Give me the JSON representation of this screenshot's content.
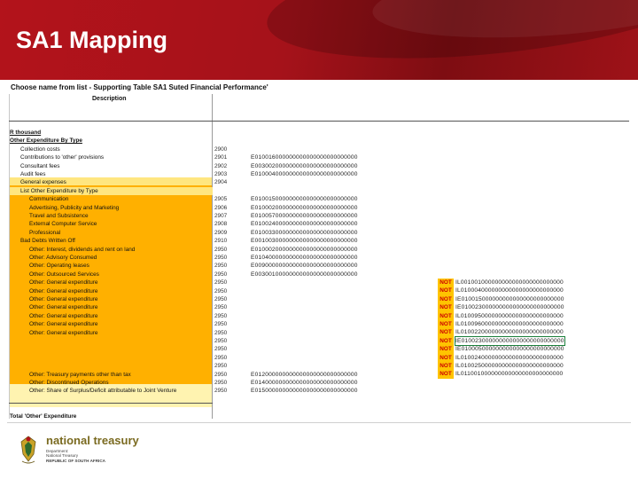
{
  "slide": {
    "title": "SA1 Mapping"
  },
  "sheet": {
    "title": "Choose name from list - Supporting Table SA1 Suted Financial Performance'",
    "description_header": "Description",
    "rows": [
      {
        "label": "R thousand",
        "code": "",
        "mapping": "",
        "style": "bold u"
      },
      {
        "label": "Other Expenditure By Type",
        "code": "",
        "mapping": "",
        "style": "bold u"
      },
      {
        "label": "Collection costs",
        "code": "2900",
        "mapping": "",
        "style": "indent1"
      },
      {
        "label": "Contributions to 'other' provisions",
        "code": "2901",
        "mapping": "E010016000000000000000000000000",
        "style": "indent1"
      },
      {
        "label": "Consultant fees",
        "code": "2902",
        "mapping": "E003002000000000000000000000000",
        "style": "indent1"
      },
      {
        "label": "Audit fees",
        "code": "2903",
        "mapping": "E010004000000000000000000000000",
        "style": "indent1"
      },
      {
        "label": "General expenses",
        "code": "2904",
        "mapping": "",
        "style": "indent1"
      },
      {
        "label": "List Other Expenditure by Type",
        "code": "",
        "mapping": "",
        "style": "indent1 yellow-bar"
      },
      {
        "label": "Communication",
        "code": "2905",
        "mapping": "E010015000000000000000000000000",
        "style": "indent2"
      },
      {
        "label": "Advertising, Publicity and Marketing",
        "code": "2906",
        "mapping": "E010002000000000000000000000000",
        "style": "indent2"
      },
      {
        "label": "Travel and Subsistence",
        "code": "2907",
        "mapping": "E010057000000000000000000000000",
        "style": "indent2"
      },
      {
        "label": "External Computer Service",
        "code": "2908",
        "mapping": "E010024000000000000000000000000",
        "style": "indent2"
      },
      {
        "label": "Professional",
        "code": "2909",
        "mapping": "E010033000000000000000000000000",
        "style": "indent2"
      },
      {
        "label": "Bad Debts Written Off",
        "code": "2910",
        "mapping": "E001003000000000000000000000000",
        "style": "indent1"
      },
      {
        "label": "Other: Interest, dividends and rent on land",
        "code": "2950",
        "mapping": "E010002000000000000000000000000",
        "style": "indent2"
      },
      {
        "label": "Other: Advisory Consumed",
        "code": "2950",
        "mapping": "E010400000000000000000000000000",
        "style": "indent2"
      },
      {
        "label": "Other: Operating leases",
        "code": "2950",
        "mapping": "E009000000000000000000000000000",
        "style": "indent2"
      },
      {
        "label": "Other: Outsourced Services",
        "code": "2950",
        "mapping": "E003001000000000000000000000000",
        "style": "indent2"
      },
      {
        "label": "Other: General expenditure",
        "code": "2950",
        "mapping": "",
        "style": "indent2"
      },
      {
        "label": "Other: General expenditure",
        "code": "2950",
        "mapping": "",
        "style": "indent2"
      },
      {
        "label": "Other: General expenditure",
        "code": "2950",
        "mapping": "",
        "style": "indent2"
      },
      {
        "label": "Other: General expenditure",
        "code": "2950",
        "mapping": "",
        "style": "indent2"
      },
      {
        "label": "Other: General expenditure",
        "code": "2950",
        "mapping": "",
        "style": "indent2"
      },
      {
        "label": "Other: General expenditure",
        "code": "2950",
        "mapping": "",
        "style": "indent2"
      },
      {
        "label": "Other: General expenditure",
        "code": "2950",
        "mapping": "",
        "style": "indent2"
      },
      {
        "label": "",
        "code": "2950",
        "mapping": "",
        "style": "indent2"
      },
      {
        "label": "",
        "code": "2950",
        "mapping": "",
        "style": "indent2"
      },
      {
        "label": "",
        "code": "2950",
        "mapping": "",
        "style": "indent2"
      },
      {
        "label": "",
        "code": "2950",
        "mapping": "",
        "style": "indent2"
      },
      {
        "label": "Other: Treasury payments other than tax",
        "code": "2950",
        "mapping": "E012000000000000000000000000000",
        "style": "indent2"
      },
      {
        "label": "Other: Discontinued Operations",
        "code": "2950",
        "mapping": "E014000000000000000000000000000",
        "style": "indent2"
      },
      {
        "label": "Other: Share of Surplus/Deficit attributable to Joint Venture",
        "code": "2950",
        "mapping": "E015000000000000000000000000000",
        "style": "indent2"
      },
      {
        "label": "",
        "code": "",
        "mapping": "",
        "style": ""
      },
      {
        "label": "",
        "code": "",
        "mapping": "",
        "style": ""
      },
      {
        "label": "Total 'Other' Expenditure",
        "code": "",
        "mapping": "",
        "style": "bold"
      }
    ],
    "not_items": [
      {
        "label": "NOT",
        "code": "IL001001000000000000000000000000"
      },
      {
        "label": "NOT",
        "code": "IL010004000000000000000000000000"
      },
      {
        "label": "NOT",
        "code": "IE010015000000000000000000000000"
      },
      {
        "label": "NOT",
        "code": "IE010023000000000000000000000000"
      },
      {
        "label": "NOT",
        "code": "IL010095000000000000000000000000"
      },
      {
        "label": "NOT",
        "code": "IL010096000000000000000000000000"
      },
      {
        "label": "NOT",
        "code": "IL010022000000000000000000000000"
      },
      {
        "label": "NOT",
        "code": "IE010023000000000000000000000000",
        "selected": true
      },
      {
        "label": "NOT",
        "code": "IE010005000000000000000000000000"
      },
      {
        "label": "NOT",
        "code": "IL010024000000000000000000000000"
      },
      {
        "label": "NOT",
        "code": "IL010025000000000000000000000000"
      },
      {
        "label": "NOT",
        "code": "IL011001000000000000000000000000"
      }
    ]
  },
  "footer": {
    "brand": "national treasury",
    "line1": "Department:",
    "line2": "National Treasury",
    "line3": "REPUBLIC OF SOUTH AFRICA"
  },
  "colors": {
    "banner": "#b3131b",
    "orange_fill": "#ffb000",
    "yellow_fill": "#ffe680",
    "not_text": "#cc0000"
  }
}
